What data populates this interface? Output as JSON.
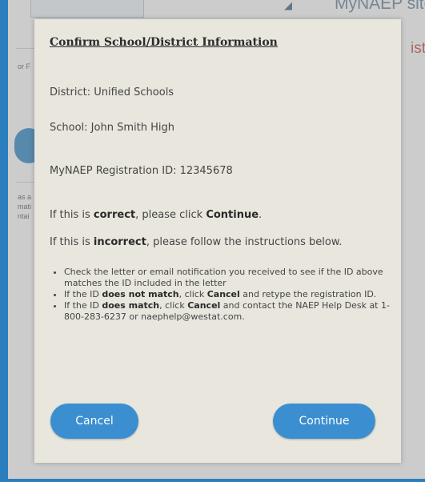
{
  "background": {
    "site_text": "MyNAEP site",
    "right_text": "ist",
    "left_snippets": [
      "or F",
      "as a",
      "mati",
      "ntai"
    ]
  },
  "modal": {
    "title": "Confirm School/District Information",
    "district": "District: Unified Schools",
    "school": "School: John Smith High",
    "registration_id": "MyNAEP Registration ID: 12345678",
    "correct_line": {
      "prefix": "If this is ",
      "emph": "correct",
      "middle": ", please click ",
      "action": "Continue",
      "suffix": "."
    },
    "incorrect_line": {
      "prefix": "If this is ",
      "emph": "incorrect",
      "suffix": ", please follow the instructions below."
    },
    "bullets": [
      {
        "text": "Check the letter or email notification you received to see if the ID above matches the ID included in the letter"
      },
      {
        "a": "If the ID ",
        "b": "does not match",
        "c": ", click ",
        "d": "Cancel",
        "e": " and retype the registration ID."
      },
      {
        "a": "If the ID ",
        "b": "does match",
        "c": ", click ",
        "d": "Cancel",
        "e": " and contact the NAEP Help Desk at 1-800-283-6237 or naephelp@westat.com."
      }
    ],
    "cancel_label": "Cancel",
    "continue_label": "Continue"
  }
}
